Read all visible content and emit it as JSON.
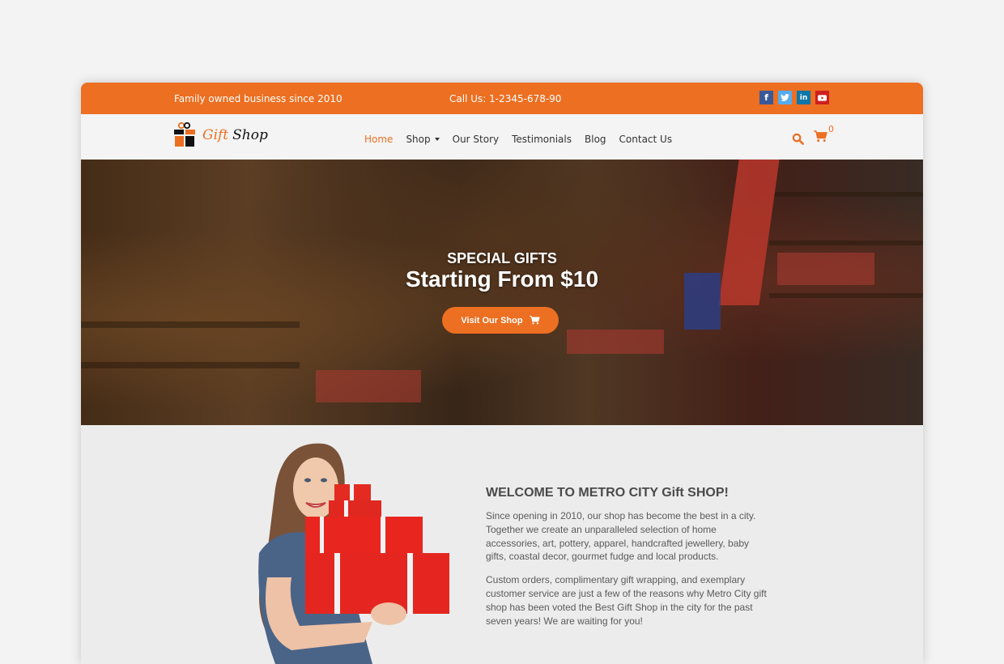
{
  "topbar": {
    "tagline": "Family owned business since 2010",
    "phone": "Call Us: 1-2345-678-90",
    "socials": [
      {
        "name": "facebook",
        "glyph": "f",
        "color": "#3b5998"
      },
      {
        "name": "twitter",
        "glyph": "t",
        "color": "#55acee"
      },
      {
        "name": "linkedin",
        "glyph": "in",
        "color": "#0e76a8"
      },
      {
        "name": "youtube",
        "glyph": "▶",
        "color": "#cd201f"
      }
    ]
  },
  "brand": {
    "word1": "Gift",
    "word2": "Shop",
    "accent": "#ec6f22"
  },
  "nav": {
    "items": [
      {
        "label": "Home",
        "active": true
      },
      {
        "label": "Shop",
        "dropdown": true
      },
      {
        "label": "Our Story"
      },
      {
        "label": "Testimonials"
      },
      {
        "label": "Blog"
      },
      {
        "label": "Contact Us"
      }
    ],
    "cart_count": "0"
  },
  "hero": {
    "subtitle": "SPECIAL GIFTS",
    "title": "Starting From $10",
    "button_label": "Visit Our Shop"
  },
  "welcome": {
    "title": "WELCOME TO METRO CITY Gift SHOP!",
    "paragraphs": [
      "Since opening in 2010, our shop has become the best in a city. Together we create an unparalleled selection of home accessories, art, pottery, apparel, handcrafted jewellery, baby gifts, coastal decor, gourmet fudge and local products.",
      "Custom orders, complimentary gift wrapping, and exemplary customer service are just a few of the reasons why Metro City gift shop has been voted the Best Gift Shop in the city for the past seven years! We are waiting for you!"
    ]
  }
}
